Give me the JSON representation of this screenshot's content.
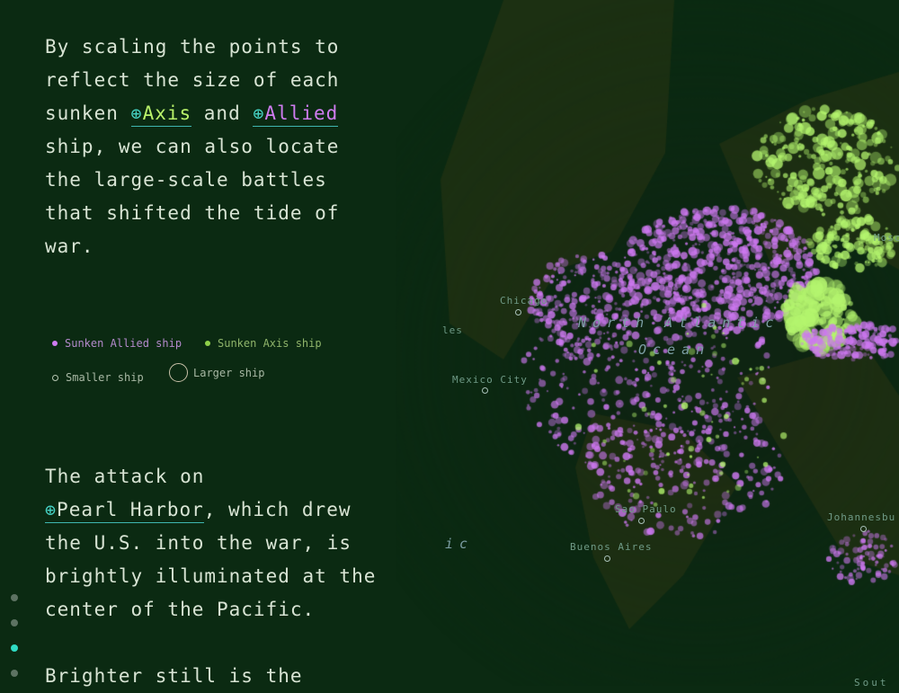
{
  "story": {
    "para1": {
      "before": "By scaling the points to reflect the size of each sunken ",
      "axis_link": "Axis",
      "middle": " and ",
      "allied_link": "Allied",
      "after": " ship, we can also locate the large-scale battles that shifted the tide of war."
    },
    "para2": {
      "before": "The attack on ",
      "link": "Pearl Harbor",
      "after": ", which drew the U.S. into the war, is brightly illuminated at the center of the Pacific."
    },
    "para3": "Brighter still is the",
    "plus_icon": "⊕"
  },
  "legend": {
    "allied": "Sunken Allied ship",
    "axis": "Sunken Axis ship",
    "smaller": "Smaller ship",
    "larger": "Larger ship"
  },
  "colors": {
    "allied": "#cf7cf0",
    "axis": "#b9f26a",
    "background": "#0b2a12",
    "accent": "#2fdcc4"
  },
  "map": {
    "labels": {
      "chicago": "Chicago",
      "los_angeles": "les",
      "mexico_city": "Mexico City",
      "north_atlantic": "North Atlantic",
      "ocean": "Ocean",
      "sao_paulo": "Sao Paulo",
      "buenos_aires": "Buenos Aires",
      "johannesburg": "Johannesbu",
      "moscow": "Mosc",
      "pacific": "ic",
      "south": "Sout"
    }
  },
  "nav": {
    "count": 4,
    "active_index": 2
  }
}
